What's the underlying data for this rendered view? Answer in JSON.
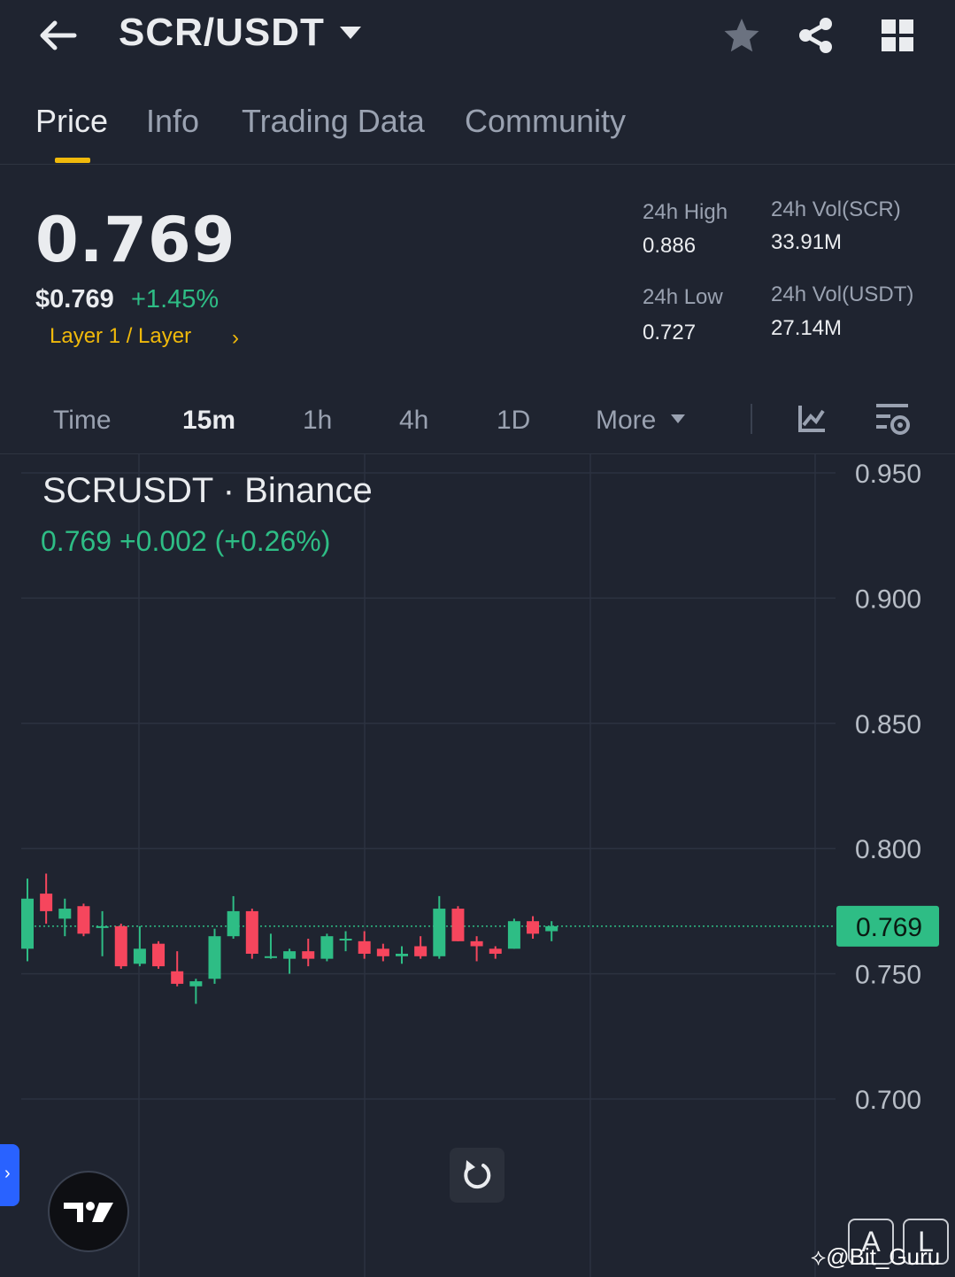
{
  "header": {
    "pair": "SCR/USDT",
    "icons": [
      "back-arrow-icon",
      "star-icon",
      "share-icon",
      "grid-icon"
    ]
  },
  "tabs": [
    "Price",
    "Info",
    "Trading Data",
    "Community"
  ],
  "ticker": {
    "last_price": "0.769",
    "usd_price": "$0.769",
    "change_pct": "+1.45%",
    "category": "Layer 1 / Layer",
    "high_label": "24h High",
    "high_value": "0.886",
    "low_label": "24h Low",
    "low_value": "0.727",
    "vol_base_label": "24h Vol(SCR)",
    "vol_base_value": "33.91M",
    "vol_quote_label": "24h Vol(USDT)",
    "vol_quote_value": "27.14M"
  },
  "intervals": {
    "time": "Time",
    "i15m": "15m",
    "i1h": "1h",
    "i4h": "4h",
    "i1d": "1D",
    "more": "More"
  },
  "chart": {
    "title": "SCRUSDT · Binance",
    "ohlc_line": "0.769  +0.002 (+0.26%)",
    "current_price_tag": "0.769",
    "btn_a": "A",
    "btn_l": "L",
    "watermark": "@Bit_Guru"
  },
  "colors": {
    "up": "#2ebd85",
    "down": "#f6465d",
    "accent": "#f0b90b",
    "background": "#1f2430"
  },
  "chart_data": {
    "type": "candlestick",
    "interval": "15m",
    "y_ticks": [
      0.95,
      0.9,
      0.85,
      0.8,
      0.75,
      0.7
    ],
    "ylim": [
      0.668,
      0.958
    ],
    "last_price": 0.769,
    "candles": [
      {
        "o": 0.76,
        "h": 0.788,
        "l": 0.755,
        "c": 0.78
      },
      {
        "o": 0.782,
        "h": 0.79,
        "l": 0.77,
        "c": 0.775
      },
      {
        "o": 0.772,
        "h": 0.78,
        "l": 0.765,
        "c": 0.776
      },
      {
        "o": 0.777,
        "h": 0.778,
        "l": 0.765,
        "c": 0.766
      },
      {
        "o": 0.769,
        "h": 0.775,
        "l": 0.757,
        "c": 0.769
      },
      {
        "o": 0.769,
        "h": 0.77,
        "l": 0.752,
        "c": 0.753
      },
      {
        "o": 0.754,
        "h": 0.769,
        "l": 0.753,
        "c": 0.76
      },
      {
        "o": 0.762,
        "h": 0.763,
        "l": 0.752,
        "c": 0.753
      },
      {
        "o": 0.751,
        "h": 0.759,
        "l": 0.745,
        "c": 0.746
      },
      {
        "o": 0.745,
        "h": 0.748,
        "l": 0.738,
        "c": 0.747
      },
      {
        "o": 0.748,
        "h": 0.768,
        "l": 0.746,
        "c": 0.765
      },
      {
        "o": 0.765,
        "h": 0.781,
        "l": 0.764,
        "c": 0.775
      },
      {
        "o": 0.775,
        "h": 0.776,
        "l": 0.756,
        "c": 0.758
      },
      {
        "o": 0.757,
        "h": 0.766,
        "l": 0.756,
        "c": 0.757
      },
      {
        "o": 0.756,
        "h": 0.76,
        "l": 0.75,
        "c": 0.759
      },
      {
        "o": 0.759,
        "h": 0.764,
        "l": 0.753,
        "c": 0.756
      },
      {
        "o": 0.756,
        "h": 0.766,
        "l": 0.755,
        "c": 0.765
      },
      {
        "o": 0.764,
        "h": 0.767,
        "l": 0.759,
        "c": 0.764
      },
      {
        "o": 0.763,
        "h": 0.767,
        "l": 0.756,
        "c": 0.758
      },
      {
        "o": 0.76,
        "h": 0.762,
        "l": 0.755,
        "c": 0.757
      },
      {
        "o": 0.757,
        "h": 0.761,
        "l": 0.754,
        "c": 0.758
      },
      {
        "o": 0.761,
        "h": 0.765,
        "l": 0.756,
        "c": 0.757
      },
      {
        "o": 0.757,
        "h": 0.781,
        "l": 0.756,
        "c": 0.776
      },
      {
        "o": 0.776,
        "h": 0.777,
        "l": 0.763,
        "c": 0.763
      },
      {
        "o": 0.763,
        "h": 0.765,
        "l": 0.755,
        "c": 0.761
      },
      {
        "o": 0.76,
        "h": 0.761,
        "l": 0.756,
        "c": 0.758
      },
      {
        "o": 0.76,
        "h": 0.772,
        "l": 0.76,
        "c": 0.771
      },
      {
        "o": 0.771,
        "h": 0.773,
        "l": 0.764,
        "c": 0.766
      },
      {
        "o": 0.767,
        "h": 0.771,
        "l": 0.763,
        "c": 0.769
      }
    ]
  }
}
